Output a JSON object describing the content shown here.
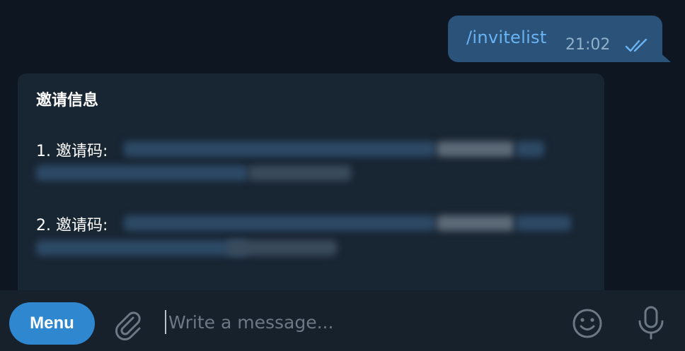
{
  "messages": {
    "outgoing": {
      "text": "/invitelist",
      "time": "21:02",
      "status_icon": "double-check-icon"
    },
    "incoming": {
      "title": "邀请信息",
      "line1_label": "1. 邀请码:",
      "line2_label": "2. 邀请码:"
    }
  },
  "composer": {
    "menu_label": "Menu",
    "placeholder": "Write a message...",
    "attach_icon": "paperclip-icon",
    "emoji_icon": "smile-icon",
    "mic_icon": "microphone-icon"
  },
  "colors": {
    "background": "#0e1621",
    "outgoing_bubble": "#2b5278",
    "incoming_bubble": "#182533",
    "composer": "#17212b",
    "accent": "#2f87cf",
    "link": "#6ab3f3"
  }
}
